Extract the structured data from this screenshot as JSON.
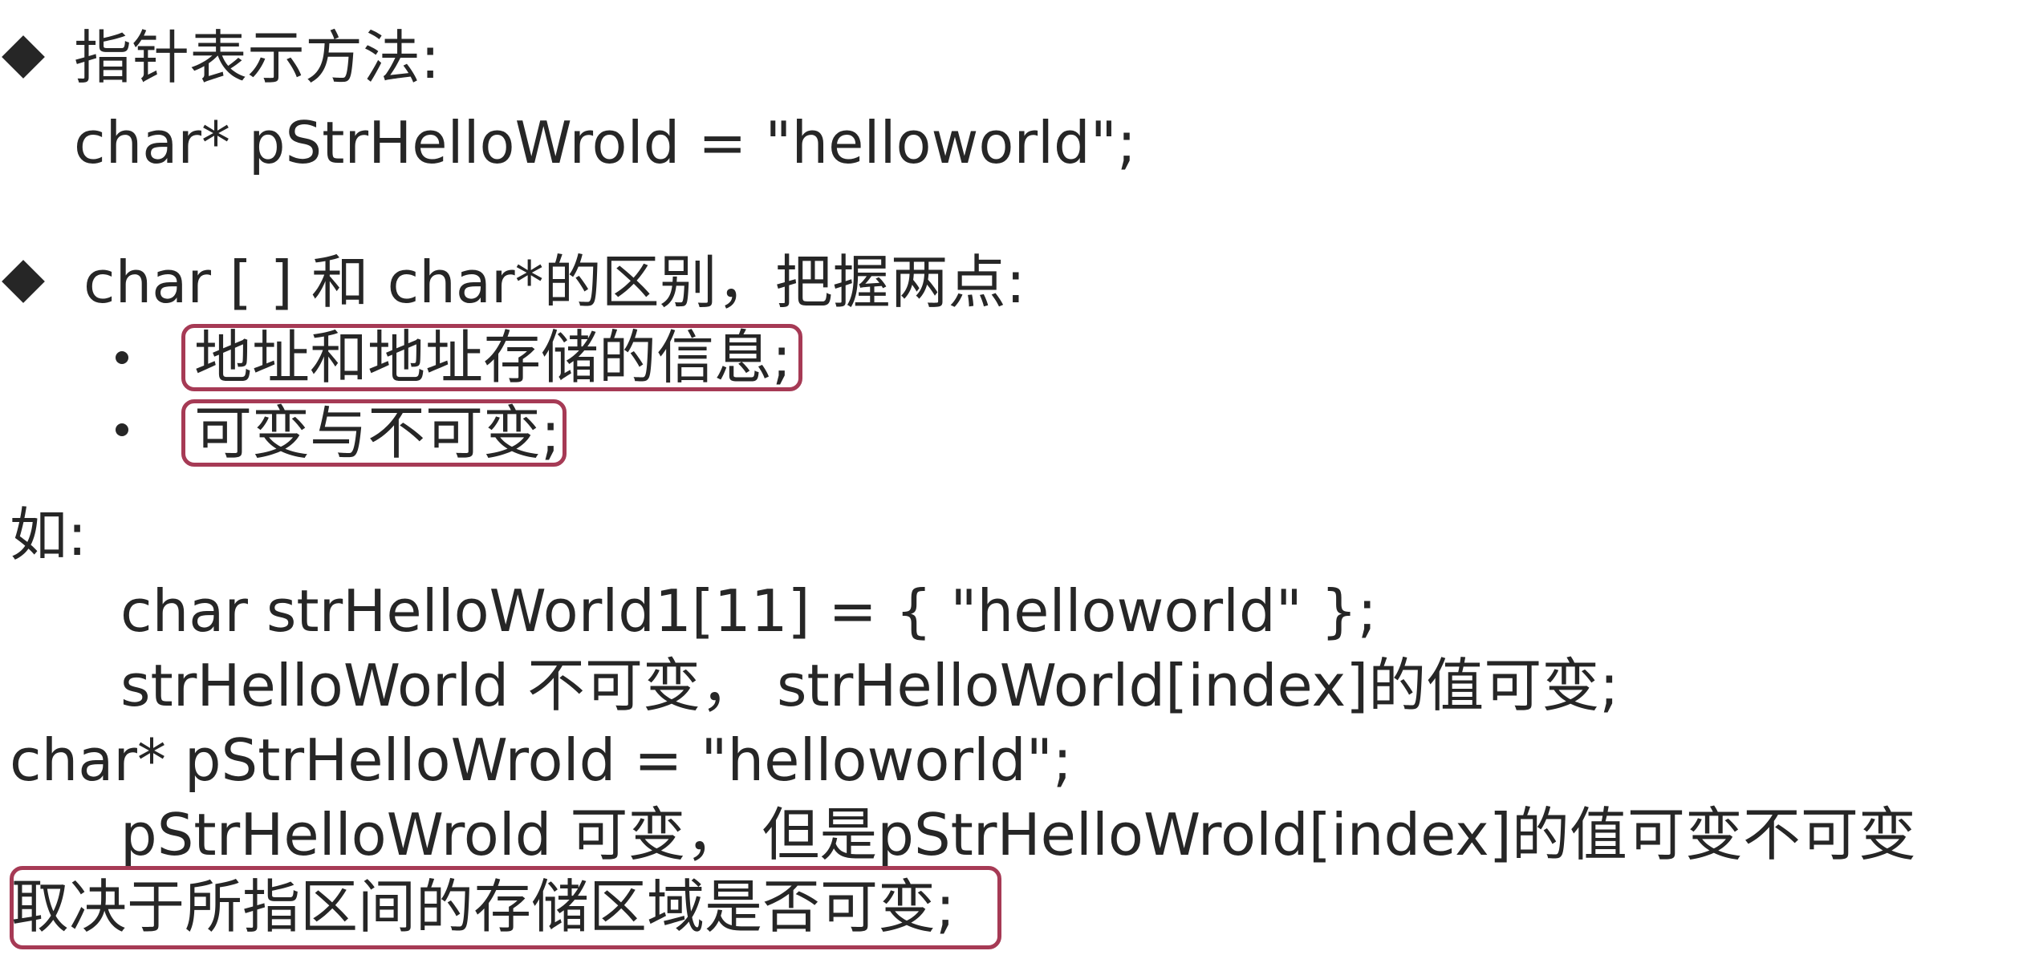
{
  "section1": {
    "heading": "指针表示方法:",
    "code": "char* pStrHelloWrold = \"helloworld\";"
  },
  "section2": {
    "heading": "char [ ] 和 char*的区别，把握两点:",
    "points": [
      {
        "text": "地址和地址存储的信息",
        "suffix": ";"
      },
      {
        "text": "可变与不可变",
        "suffix": ";"
      }
    ]
  },
  "example": {
    "label": "如:",
    "line1": "char strHelloWorld1[11] = { \"helloworld\" };",
    "line2": "strHelloWorld 不可变， strHelloWorld[index]的值可变;",
    "line3": "char* pStrHelloWrold = \"helloworld\";",
    "line4": "pStrHelloWrold 可变， 但是pStrHelloWrold[index]的值可变不可变",
    "line5_boxed": "取决于所指区间的存储区域是否可变",
    "line5_suffix": ";"
  },
  "colors": {
    "text": "#262626",
    "highlight_box": "#a63a55"
  }
}
